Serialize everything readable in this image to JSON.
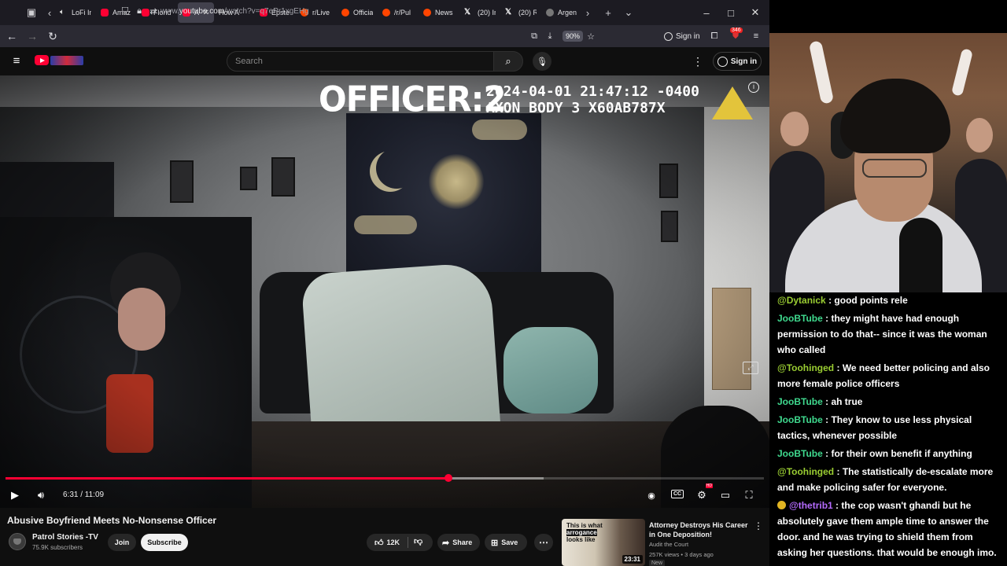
{
  "browser": {
    "tabs": [
      {
        "label": "LoFi In",
        "icon": "speaker",
        "active": false
      },
      {
        "label": "Amaz",
        "icon": "yt",
        "active": false
      },
      {
        "label": "Florid",
        "icon": "yt",
        "active": false
      },
      {
        "label": "Ab",
        "icon": "yt",
        "active": true
      },
      {
        "label": "How A",
        "icon": "none",
        "active": false
      },
      {
        "label": "Epste",
        "icon": "yt",
        "active": false
      },
      {
        "label": "r/Live",
        "icon": "reddit",
        "active": false
      },
      {
        "label": "Officia",
        "icon": "reddit",
        "active": false
      },
      {
        "label": "/r/Pul",
        "icon": "reddit",
        "active": false
      },
      {
        "label": "News",
        "icon": "reddit",
        "active": false
      },
      {
        "label": "(20) In",
        "icon": "x",
        "active": false
      },
      {
        "label": "(20) R",
        "icon": "x",
        "active": false
      },
      {
        "label": "Argen",
        "icon": "gray",
        "active": false
      }
    ],
    "url_prefix": "www.",
    "url_domain": "youtube.com",
    "url_path": "/watch?v=q7ePr1xgEHg",
    "zoom": "90%",
    "sign_in": "Sign in",
    "ext_badge": "346"
  },
  "youtube": {
    "search_placeholder": "Search",
    "sign_in": "Sign in"
  },
  "video": {
    "overlay_officer": "OFFICER:2",
    "overlay_timestamp": "2024-04-01 21:47:12 -0400\nAXON BODY 3 X60AB787X",
    "current_time": "6:31",
    "duration": "11:09",
    "time_display": "6:31 / 11:09",
    "played_fraction": 0.584,
    "buffered_fraction": 0.71,
    "title": "Abusive Boyfriend Meets No-Nonsense Officer",
    "channel": "Patrol Stories -TV",
    "subscribers": "75.9K subscribers",
    "join_label": "Join",
    "subscribe_label": "Subscribe",
    "likes": "12K",
    "share_label": "Share",
    "save_label": "Save",
    "hd_badge": "HD"
  },
  "recommendation": {
    "thumb_text_a": "This is what",
    "thumb_text_b": "arrogance",
    "thumb_text_c": "looks like",
    "duration": "23:31",
    "title": "Attorney Destroys His Career in One Deposition!",
    "channel": "Audit the Court",
    "meta": "257K views • 3 days ago",
    "badge": "New"
  },
  "chat": [
    {
      "user": "@Dytanick",
      "color": "#9acd32",
      "text": "good points rele",
      "badge": false
    },
    {
      "user": "JooBTube",
      "color": "#3fd98e",
      "text": "they might have had enough permission to do that-- since it was the woman who called",
      "badge": false
    },
    {
      "user": "@Toohinged",
      "color": "#9acd32",
      "text": "We need better policing and also more female police officers",
      "badge": false
    },
    {
      "user": "JooBTube",
      "color": "#3fd98e",
      "text": "ah true",
      "badge": false
    },
    {
      "user": "JooBTube",
      "color": "#3fd98e",
      "text": "They know to use less physical tactics, whenever possible",
      "badge": false
    },
    {
      "user": "JooBTube",
      "color": "#3fd98e",
      "text": "for their own benefit if anything",
      "badge": false
    },
    {
      "user": "@Toohinged",
      "color": "#9acd32",
      "text": "The statistically de-escalate more and make policing safer for everyone.",
      "badge": false
    },
    {
      "user": "@thetrib1",
      "color": "#b56bff",
      "text": "the cop wasn't ghandi but he absolutely gave them ample time to answer the door. and he was trying to shield them from asking her questions. that would be enough imo.",
      "badge": true
    }
  ]
}
